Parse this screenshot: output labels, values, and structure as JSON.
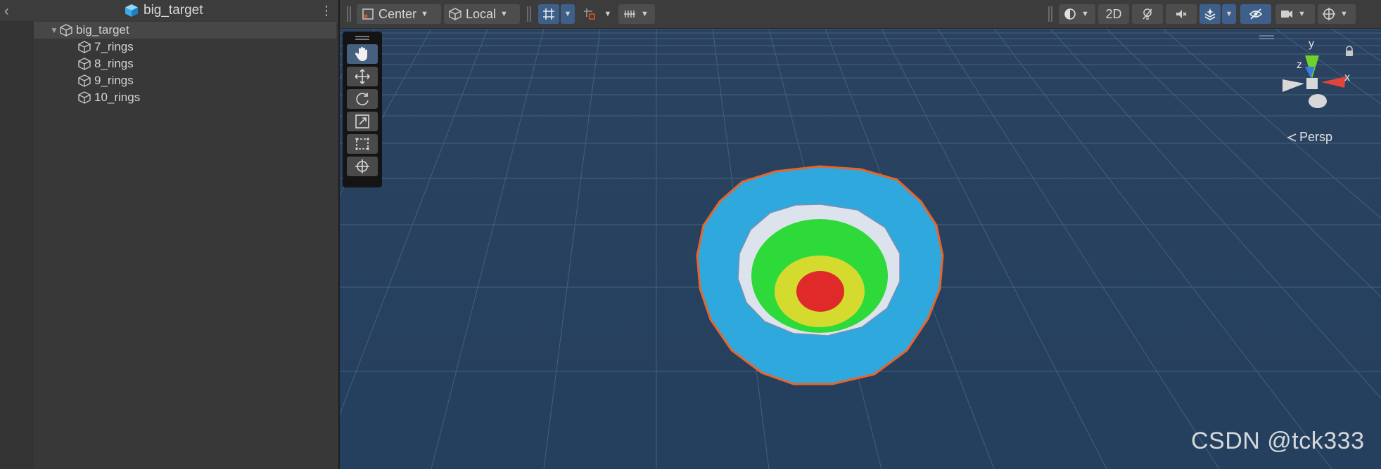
{
  "hierarchy": {
    "title": "big_target",
    "tree": [
      {
        "name": "big_target",
        "level": 0,
        "expanded": true
      },
      {
        "name": "7_rings",
        "level": 1
      },
      {
        "name": "8_rings",
        "level": 1
      },
      {
        "name": "9_rings",
        "level": 1
      },
      {
        "name": "10_rings",
        "level": 1
      }
    ]
  },
  "toolbar": {
    "pivot_mode": "Center",
    "pivot_rotation": "Local",
    "mode_2d": "2D"
  },
  "viewport": {
    "projection_label": "Persp",
    "gizmo_axes": {
      "y": "y",
      "z": "z",
      "x": "x"
    },
    "watermark": "CSDN @tck333"
  },
  "colors": {
    "ring_outer": "#2ea8dd",
    "ring_white": "#dde3ec",
    "ring_green": "#2ed93a",
    "ring_yellow": "#d4db2e",
    "ring_center": "#e02a2a",
    "ring_outline": "#e8652a",
    "accent": "#3d5f8a"
  }
}
